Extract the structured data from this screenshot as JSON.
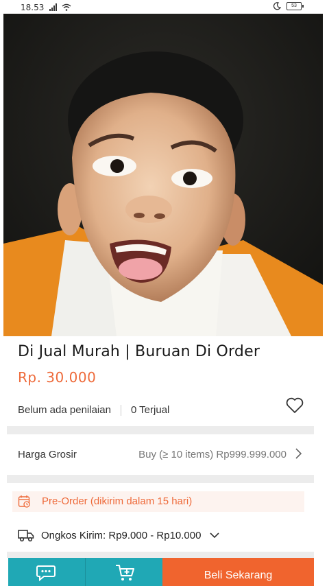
{
  "status_bar": {
    "time": "18.53",
    "battery": "53"
  },
  "product": {
    "title": "Di Jual Murah | Buruan Di Order",
    "price": "Rp. 30.000",
    "rating_text": "Belum ada penilaian",
    "sold_text": "0 Terjual"
  },
  "wholesale": {
    "label": "Harga Grosir",
    "value": "Buy (≥ 10 items) Rp999.999.000"
  },
  "preorder": {
    "text": "Pre-Order (dikirim dalam 15 hari)"
  },
  "shipping": {
    "text": "Ongkos Kirim: Rp9.000 - Rp10.000"
  },
  "bottom_bar": {
    "buy_label": "Beli Sekarang"
  },
  "colors": {
    "accent_orange": "#ee6a3a",
    "teal": "#20a8b5",
    "buy_button": "#f0642e"
  }
}
